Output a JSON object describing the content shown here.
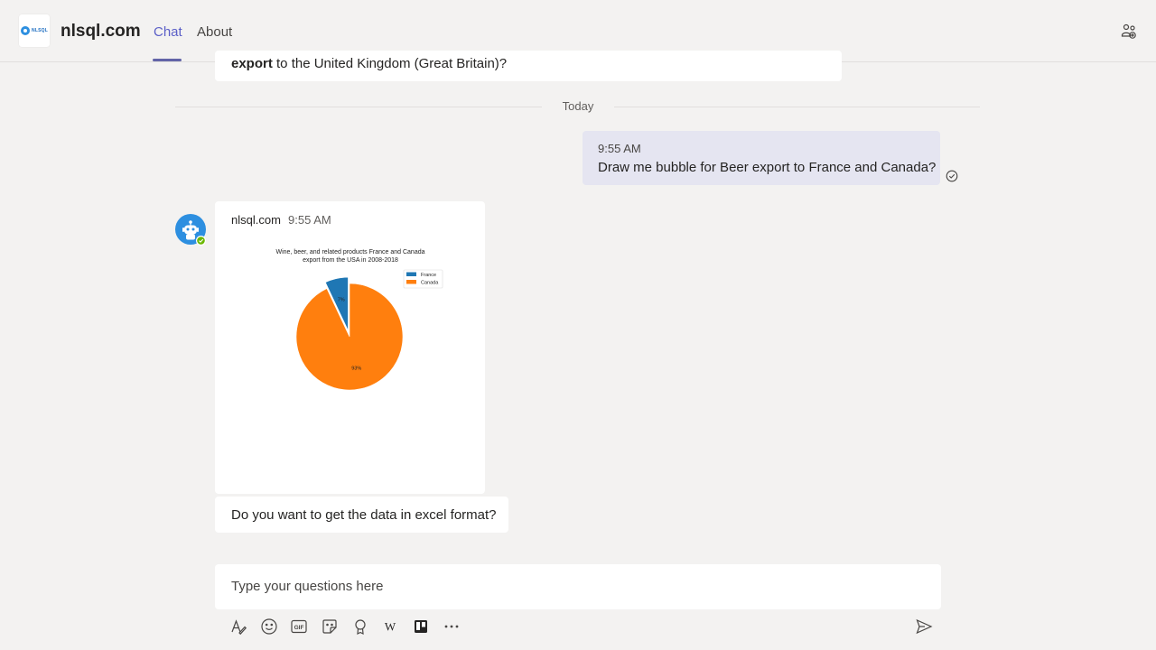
{
  "header": {
    "logo_text": "NLSQL",
    "app_title": "nlsql.com",
    "tabs": [
      {
        "label": "Chat",
        "active": true
      },
      {
        "label": "About",
        "active": false
      }
    ],
    "right_icon": "people-settings-icon"
  },
  "conversation": {
    "previous_message": {
      "bold": "export",
      "text": " to the United Kingdom (Great Britain)?"
    },
    "divider_label": "Today",
    "user_message": {
      "time": "9:55 AM",
      "text": "Draw me bubble for Beer export to France and Canada?",
      "status_icon": "read-check-icon"
    },
    "bot_message": {
      "sender": "nlsql.com",
      "time": "9:55 AM",
      "avatar_icon": "bot-avatar-icon",
      "followup": "Do you want to get the data in excel format?"
    }
  },
  "chart_data": {
    "type": "pie",
    "title_lines": [
      "Wine, beer, and related products France and Canada",
      "export from the USA in 2008-2018"
    ],
    "categories": [
      "France",
      "Canada"
    ],
    "values": [
      7,
      93
    ],
    "labels": [
      "7%",
      "93%"
    ],
    "colors": [
      "#1f77b4",
      "#ff7f0e"
    ],
    "explode": [
      0.12,
      0
    ],
    "legend_position": "top-right"
  },
  "compose": {
    "placeholder": "Type your questions here",
    "toolbar": [
      "format-icon",
      "emoji-icon",
      "gif-icon",
      "sticker-icon",
      "praise-icon",
      "wikipedia-icon",
      "trello-icon",
      "more-options-icon"
    ],
    "send_icon": "send-icon"
  },
  "colors": {
    "accent": "#6264a7",
    "background": "#f3f2f1",
    "user_bubble": "#e5e5f1"
  }
}
